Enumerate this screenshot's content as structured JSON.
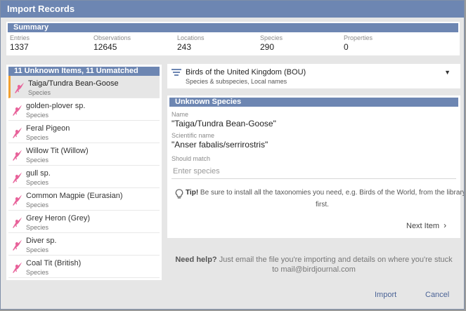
{
  "window": {
    "title": "Import Records"
  },
  "summary": {
    "header": "Summary",
    "stats": [
      {
        "label": "Entries",
        "value": "1337"
      },
      {
        "label": "Observations",
        "value": "12645"
      },
      {
        "label": "Locations",
        "value": "243"
      },
      {
        "label": "Species",
        "value": "290"
      },
      {
        "label": "Properties",
        "value": "0"
      }
    ]
  },
  "unknown_list": {
    "header": "11 Unknown Items, 11 Unmatched",
    "items": [
      {
        "name": "Taiga/Tundra Bean-Goose",
        "type": "Species"
      },
      {
        "name": "golden-plover sp.",
        "type": "Species"
      },
      {
        "name": "Feral Pigeon",
        "type": "Species"
      },
      {
        "name": "Willow Tit (Willow)",
        "type": "Species"
      },
      {
        "name": "gull sp.",
        "type": "Species"
      },
      {
        "name": "Common Magpie (Eurasian)",
        "type": "Species"
      },
      {
        "name": "Grey Heron (Grey)",
        "type": "Species"
      },
      {
        "name": "Diver sp.",
        "type": "Species"
      },
      {
        "name": "Coal Tit (British)",
        "type": "Species"
      }
    ],
    "bird_icon_color": "#e8629a",
    "selected_accent": "#f0a030"
  },
  "taxonomy": {
    "title": "Birds of the United Kingdom (BOU)",
    "subtitle": "Species & subspecies, Local names",
    "dropdown_icon": "caret-down-icon"
  },
  "detail": {
    "header": "Unknown Species",
    "name_label": "Name",
    "name_value": "\"Taiga/Tundra Bean-Goose\"",
    "sci_label": "Scientific name",
    "sci_value": "\"Anser fabalis/serrirostris\"",
    "match_label": "Should match",
    "match_placeholder": "Enter species",
    "tip_bold": "Tip!",
    "tip_text": " Be sure to install all the taxonomies you need, e.g. Birds of the World, from the library",
    "tip_text2": "first.",
    "next_label": "Next Item"
  },
  "help": {
    "bold": "Need help?",
    "text": " Just email the file you're importing and details on where you're stuck",
    "email": "to mail@birdjournal.com"
  },
  "footer": {
    "import_label": "Import",
    "cancel_label": "Cancel"
  },
  "colors": {
    "accent": "#6d86b2",
    "link": "#4b6396"
  }
}
